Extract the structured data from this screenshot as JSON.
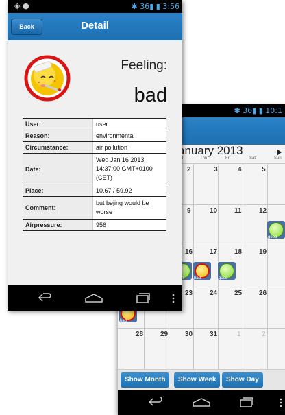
{
  "calendar_screen": {
    "status_time": "10:1",
    "status_signal": "36",
    "month_title": "anuary 2013",
    "weekdays": [
      "d",
      "Thu",
      "Fri",
      "Sat",
      "Sun"
    ],
    "week_rows": [
      [
        "2",
        "3",
        "4",
        "5",
        ""
      ],
      [
        "9",
        "10",
        "11",
        "12",
        ""
      ],
      [
        "16",
        "17",
        "18",
        "19",
        ""
      ],
      [
        "23",
        "24",
        "25",
        "26",
        ""
      ],
      [
        "28",
        "29",
        "30",
        "31",
        "1",
        "2"
      ]
    ],
    "mood_badges": [
      "good",
      "bad",
      "good",
      "good",
      "bad"
    ],
    "buttons": {
      "show_month": "Show Month",
      "show_week": "Show Week",
      "show_day": "Show Day"
    }
  },
  "detail_screen": {
    "status_time": "3:56",
    "status_signal": "36",
    "back_label": "Back",
    "title": "Detail",
    "feeling_label": "Feeling:",
    "feeling_value": "bad",
    "rows": [
      {
        "key": "User:",
        "value": "user"
      },
      {
        "key": "Reason:",
        "value": "environmental"
      },
      {
        "key": "Circumstance:",
        "value": "air pollution"
      },
      {
        "key": "Date:",
        "value": "Wed Jan 16 2013 14:37:00 GMT+0100 (CET)"
      },
      {
        "key": "Place:",
        "value": "10.67 / 59.92"
      },
      {
        "key": "Comment:",
        "value": "but bejing would be worse"
      },
      {
        "key": "Airpressure:",
        "value": "956"
      }
    ]
  },
  "colors": {
    "appbar": "#1d6fb0",
    "status_accent": "#4aa8e8",
    "bad_ring": "#d61010",
    "good_face": "#7bd62a"
  },
  "icons": [
    "back-nav-icon",
    "home-nav-icon",
    "recent-apps-icon",
    "overflow-menu-icon",
    "next-month-icon",
    "sick-face-icon"
  ]
}
